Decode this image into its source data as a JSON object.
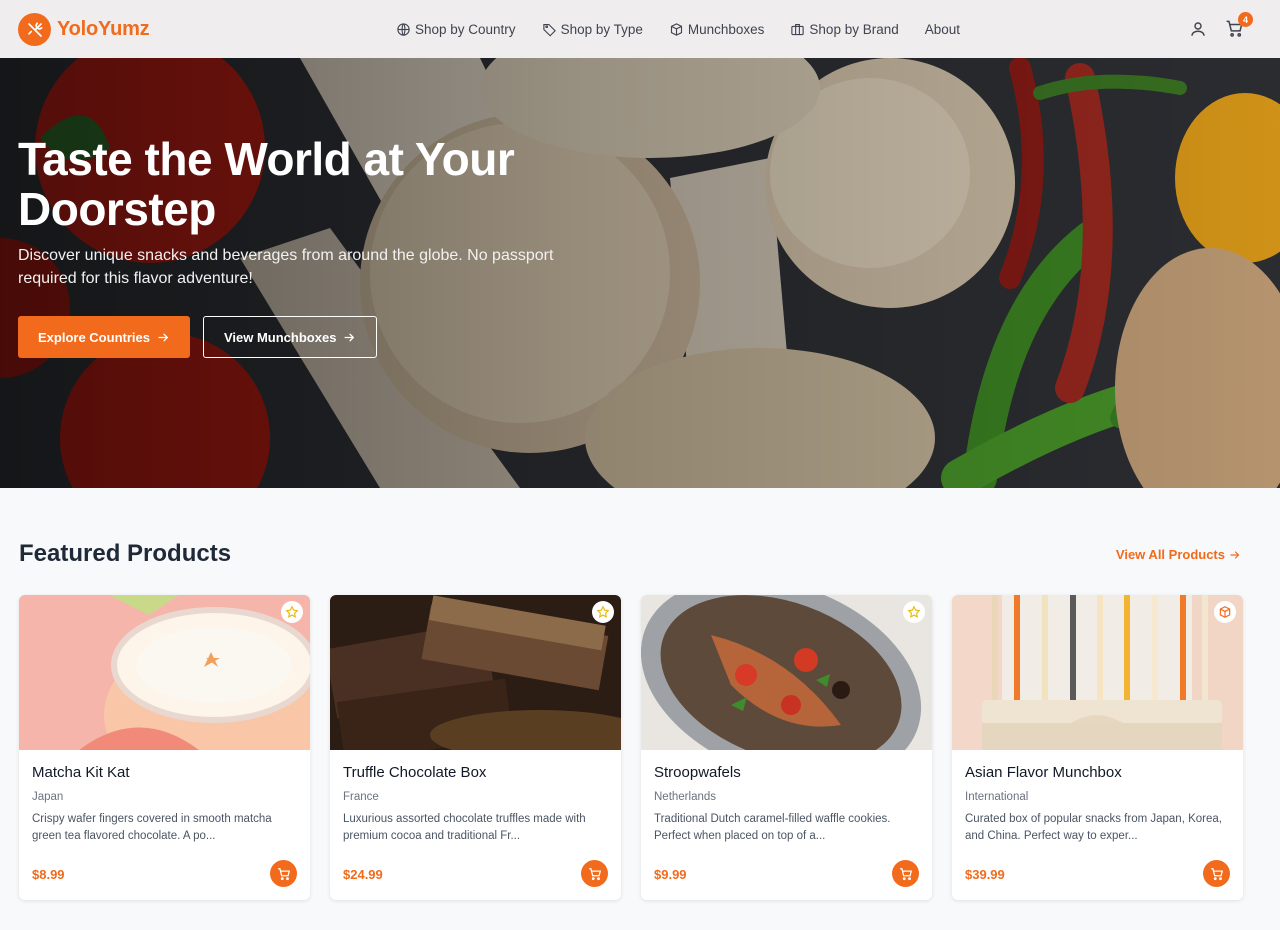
{
  "brand": {
    "name": "YoloYumz",
    "accent": "#f26a1b"
  },
  "nav": {
    "links": [
      {
        "label": "Shop by Country",
        "icon": "globe-icon"
      },
      {
        "label": "Shop by Type",
        "icon": "tag-icon"
      },
      {
        "label": "Munchboxes",
        "icon": "box-icon"
      },
      {
        "label": "Shop by Brand",
        "icon": "briefcase-icon"
      },
      {
        "label": "About",
        "icon": ""
      }
    ],
    "user_icon": "user-icon",
    "cart_icon": "cart-icon",
    "cart_count": "4"
  },
  "hero": {
    "title": "Taste the World at Your Doorstep",
    "subtitle": "Discover unique snacks and beverages from around the globe. No passport required for this flavor adventure!",
    "primary_button": "Explore Countries",
    "secondary_button": "View Munchboxes"
  },
  "featured": {
    "title": "Featured Products",
    "view_all": "View All Products",
    "products": [
      {
        "name": "Matcha Kit Kat",
        "country": "Japan",
        "description": "Crispy wafer fingers covered in smooth matcha green tea flavored chocolate. A po...",
        "price": "$8.99",
        "badge_icon": "star-icon"
      },
      {
        "name": "Truffle Chocolate Box",
        "country": "France",
        "description": "Luxurious assorted chocolate truffles made with premium cocoa and traditional Fr...",
        "price": "$24.99",
        "badge_icon": "star-icon"
      },
      {
        "name": "Stroopwafels",
        "country": "Netherlands",
        "description": "Traditional Dutch caramel-filled waffle cookies. Perfect when placed on top of a...",
        "price": "$9.99",
        "badge_icon": "star-icon"
      },
      {
        "name": "Asian Flavor Munchbox",
        "country": "International",
        "description": "Curated box of popular snacks from Japan, Korea, and China. Perfect way to exper...",
        "price": "$39.99",
        "badge_icon": "box-icon"
      }
    ]
  }
}
